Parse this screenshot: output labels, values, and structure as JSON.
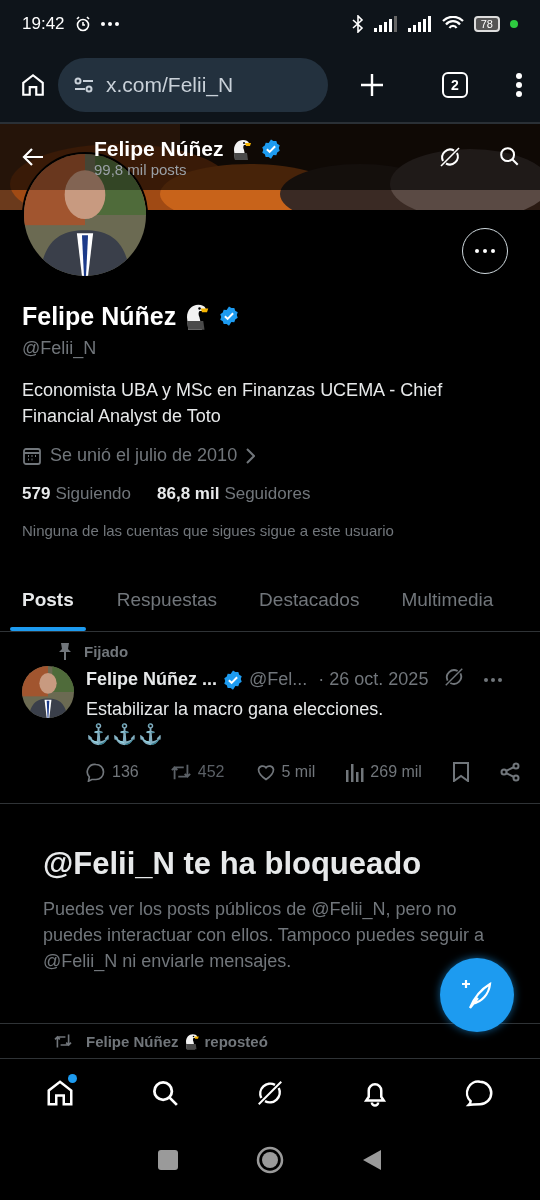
{
  "status_bar": {
    "time": "19:42",
    "battery": "78"
  },
  "browser": {
    "url": "x.com/Felii_N",
    "tab_count": "2"
  },
  "header": {
    "name": "Felipe Núñez",
    "verified": true,
    "posts": "99,8 mil posts"
  },
  "profile": {
    "name": "Felipe Núñez",
    "verified": true,
    "handle": "@Felii_N",
    "bio": "Economista UBA y MSc en Finanzas UCEMA - Chief Financial Analyst de Toto",
    "joined": "Se unió el julio de 2010",
    "following_count": "579",
    "following_label": "Siguiendo",
    "followers_count": "86,8 mil",
    "followers_label": "Seguidores",
    "note": "Ninguna de las cuentas que sigues sigue a este usuario"
  },
  "tabs": [
    {
      "label": "Posts",
      "selected": true
    },
    {
      "label": "Respuestas",
      "selected": false
    },
    {
      "label": "Destacados",
      "selected": false
    },
    {
      "label": "Multimedia",
      "selected": false
    }
  ],
  "pinned_post": {
    "pinned_label": "Fijado",
    "author": "Felipe Núñez ...",
    "verified": true,
    "handle": "@Fel...",
    "date": "· 26 oct. 2025",
    "text": "Estabilizar la macro gana elecciones.",
    "emoji": "⚓⚓⚓",
    "replies": "136",
    "reposts": "452",
    "likes": "5 mil",
    "views": "269 mil"
  },
  "blocked": {
    "title": "@Felii_N te ha bloqueado",
    "message": "Puedes ver los posts públicos de @Felii_N, pero no puedes interactuar con ellos. Tampoco puedes seguir a @Felii_N ni enviarle mensajes."
  },
  "repost": {
    "name": "Felipe Núñez",
    "action": "reposteó"
  },
  "nav": [
    {
      "kind": "home",
      "dot": true
    },
    {
      "kind": "search",
      "dot": false
    },
    {
      "kind": "grok",
      "dot": false
    },
    {
      "kind": "notifications",
      "dot": false
    },
    {
      "kind": "messages",
      "dot": false
    }
  ]
}
